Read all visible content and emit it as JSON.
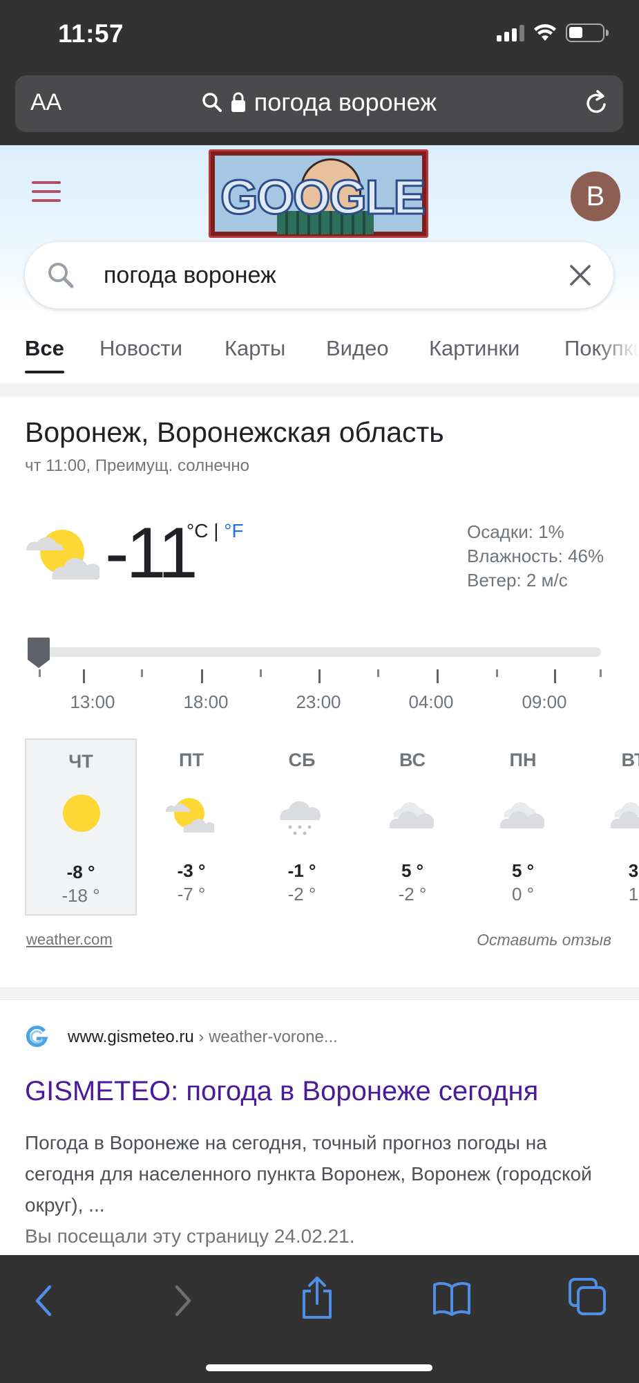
{
  "status_bar": {
    "time": "11:57",
    "icons": [
      "cellular-signal-icon",
      "wifi-icon",
      "battery-icon"
    ]
  },
  "address_bar": {
    "text_size_label": "AA",
    "url_text": "погода воронеж",
    "icons": [
      "search-icon",
      "lock-icon",
      "reload-icon"
    ]
  },
  "google_header": {
    "avatar_letter": "B",
    "doodle_text": "GOOGLE",
    "search_query": "погода воронеж",
    "icons": [
      "hamburger-menu-icon",
      "search-icon",
      "close-icon"
    ],
    "colors": {
      "hamburger": "#b0506a",
      "avatar": "#8d5e52"
    }
  },
  "tabs": {
    "all": "Все",
    "news": "Новости",
    "maps": "Карты",
    "video": "Видео",
    "images": "Картинки",
    "shopping": "Покупки"
  },
  "weather": {
    "location": "Воронеж, Воронежская область",
    "subtitle": "чт 11:00, Преимущ. солнечно",
    "temperature": "-11",
    "unit_c": "°C",
    "unit_separator": "|",
    "unit_f": "°F",
    "precipitation": "Осадки: 1%",
    "humidity": "Влажность: 46%",
    "wind": "Ветер: 2 м/с",
    "current_icon": "partly-cloudy-icon",
    "timeline_position": 0,
    "hours": [
      "13:00",
      "18:00",
      "23:00",
      "04:00",
      "09:00"
    ],
    "days": [
      {
        "name": "ЧТ",
        "icon": "sunny-icon",
        "high": "-8 °",
        "low": "-18 °",
        "selected": true
      },
      {
        "name": "ПТ",
        "icon": "partly-cloudy-icon",
        "high": "-3 °",
        "low": "-7 °"
      },
      {
        "name": "СБ",
        "icon": "snow-icon",
        "high": "-1 °",
        "low": "-2 °"
      },
      {
        "name": "ВС",
        "icon": "cloudy-icon",
        "high": "5 °",
        "low": "-2 °"
      },
      {
        "name": "ПН",
        "icon": "cloudy-icon",
        "high": "5 °",
        "low": "0 °"
      },
      {
        "name": "ВТ",
        "icon": "cloudy-icon",
        "high": "3",
        "low": "1"
      }
    ],
    "source": "weather.com",
    "feedback": "Оставить отзыв"
  },
  "result": {
    "favicon": "gismeteo-favicon-icon",
    "domain": "www.gismeteo.ru",
    "path": "› weather-vorone...",
    "title": "GISMETEO: погода в Воронеже сегодня",
    "snippet": "Погода в Воронеже на сегодня, точный прогноз погоды на сегодня для населенного пункта Воронеж, Воронеж (городской округ), ...",
    "visited": "Вы посещали эту страницу 24.02.21."
  },
  "toolbar": {
    "icons": [
      "back-icon",
      "forward-icon",
      "share-icon",
      "bookmarks-icon",
      "tabs-icon"
    ],
    "accent_color": "#4f8fe6"
  }
}
